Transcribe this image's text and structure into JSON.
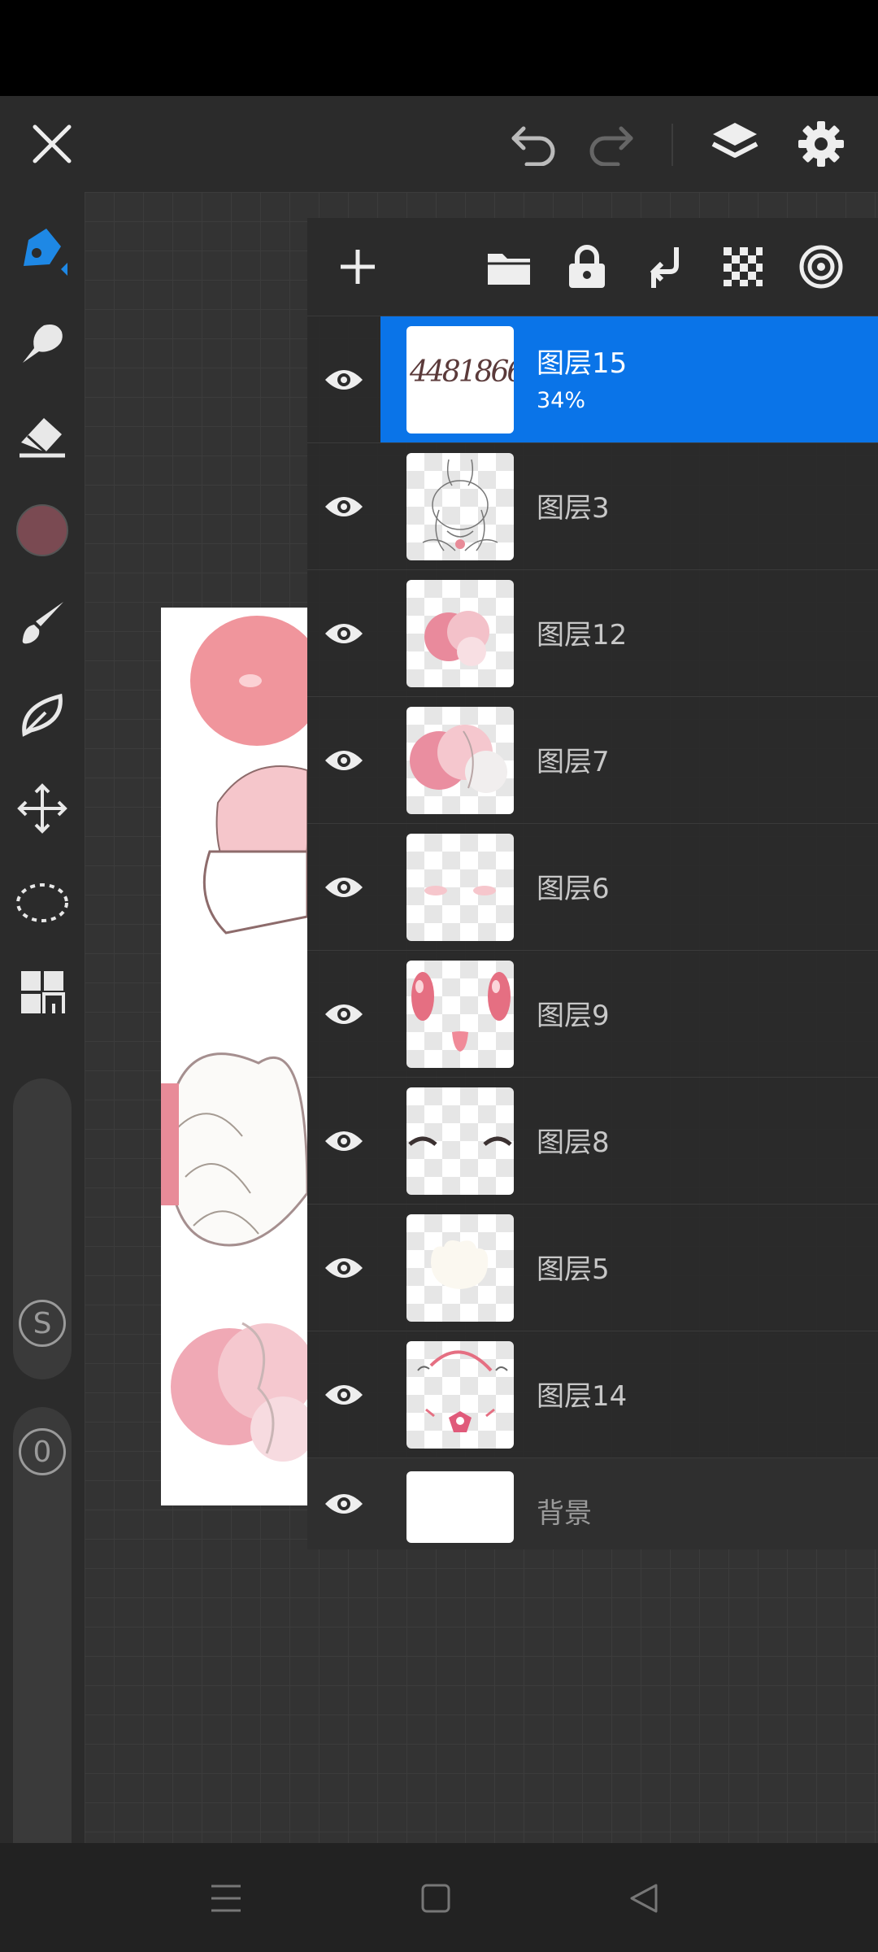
{
  "toolbar": {
    "close_icon": "close-icon",
    "undo_icon": "undo-icon",
    "redo_icon": "redo-icon",
    "layers_icon": "layers-icon",
    "settings_icon": "gear-icon"
  },
  "tools": [
    {
      "name": "pen",
      "icon": "pen-icon",
      "active": true
    },
    {
      "name": "smudge",
      "icon": "smudge-icon"
    },
    {
      "name": "eraser",
      "icon": "eraser-icon"
    },
    {
      "name": "color",
      "icon": "color-swatch",
      "color": "#7a4a52"
    },
    {
      "name": "brush",
      "icon": "brush-icon"
    },
    {
      "name": "shape",
      "icon": "leaf-icon"
    },
    {
      "name": "transform",
      "icon": "move-icon"
    },
    {
      "name": "selection",
      "icon": "lasso-icon"
    },
    {
      "name": "gallery",
      "icon": "grid-icon"
    }
  ],
  "sliders": {
    "size_label": "S",
    "opacity_label": "0"
  },
  "layers_panel": {
    "toolbar_icons": [
      "add-icon",
      "folder-icon",
      "lock-icon",
      "merge-down-icon",
      "transparency-icon",
      "blend-icon"
    ],
    "layers": [
      {
        "name": "图层15",
        "opacity": "34%",
        "selected": true,
        "thumb": "text"
      },
      {
        "name": "图层3",
        "thumb": "sketch"
      },
      {
        "name": "图层12",
        "thumb": "pink-blob"
      },
      {
        "name": "图层7",
        "thumb": "pink-blob-large"
      },
      {
        "name": "图层6",
        "thumb": "blush"
      },
      {
        "name": "图层9",
        "thumb": "eyes"
      },
      {
        "name": "图层8",
        "thumb": "eyelids"
      },
      {
        "name": "图层5",
        "thumb": "white-shape"
      },
      {
        "name": "图层14",
        "thumb": "accessories"
      },
      {
        "name": "背景",
        "thumb": "white"
      }
    ],
    "thumb_text": "4481866"
  },
  "colors": {
    "accent": "#0a74e8",
    "panel": "#2b2b2b"
  },
  "nav": {
    "menu_icon": "menu-icon",
    "home_icon": "home-icon",
    "back_icon": "back-icon"
  }
}
